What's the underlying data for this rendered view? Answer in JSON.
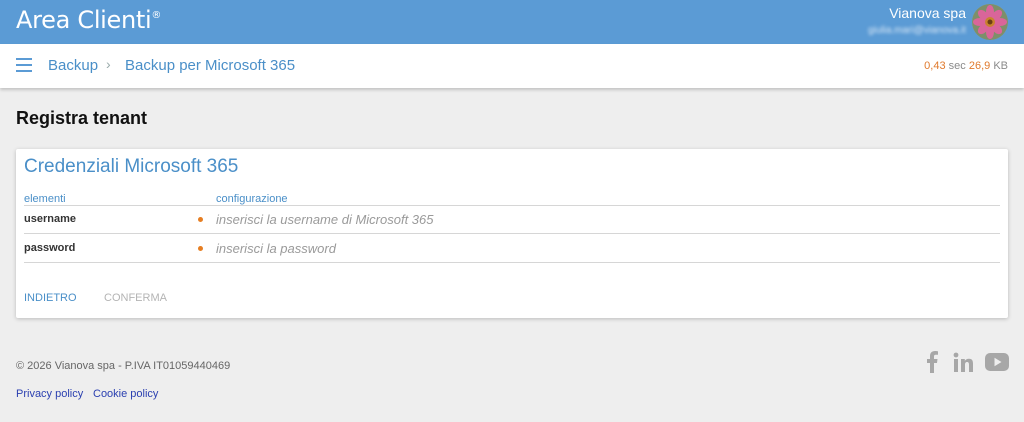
{
  "header": {
    "brand": "Area Clienti",
    "brand_mark": "®",
    "user_name": "Vianova spa",
    "user_email": "giulia.mari@vianova.it"
  },
  "breadcrumb": {
    "items": [
      "Backup",
      "Backup per Microsoft 365"
    ],
    "separator": "›"
  },
  "timing": {
    "seconds": "0,43",
    "seconds_unit": "sec",
    "size": "26,9",
    "size_unit": "KB"
  },
  "page": {
    "title": "Registra tenant"
  },
  "card": {
    "title": "Credenziali Microsoft 365",
    "col_elements": "elementi",
    "col_config": "configurazione",
    "rows": [
      {
        "label": "username",
        "placeholder": "inserisci la username di Microsoft 365",
        "value": ""
      },
      {
        "label": "password",
        "placeholder": "inserisci la password",
        "value": ""
      }
    ],
    "actions": {
      "back": "INDIETRO",
      "confirm": "CONFERMA"
    }
  },
  "footer": {
    "copyright": "© 2026 Vianova spa - P.IVA IT01059440469",
    "links": [
      "Privacy policy",
      "Cookie policy"
    ],
    "social": [
      "facebook-icon",
      "linkedin-icon",
      "youtube-icon"
    ]
  },
  "colors": {
    "header_bg": "#5b9bd5",
    "accent": "#4a8fc8",
    "required": "#e67e22",
    "timing_value": "#e07a2d",
    "link": "#2a3fb0",
    "disabled": "#b4b4b4"
  }
}
